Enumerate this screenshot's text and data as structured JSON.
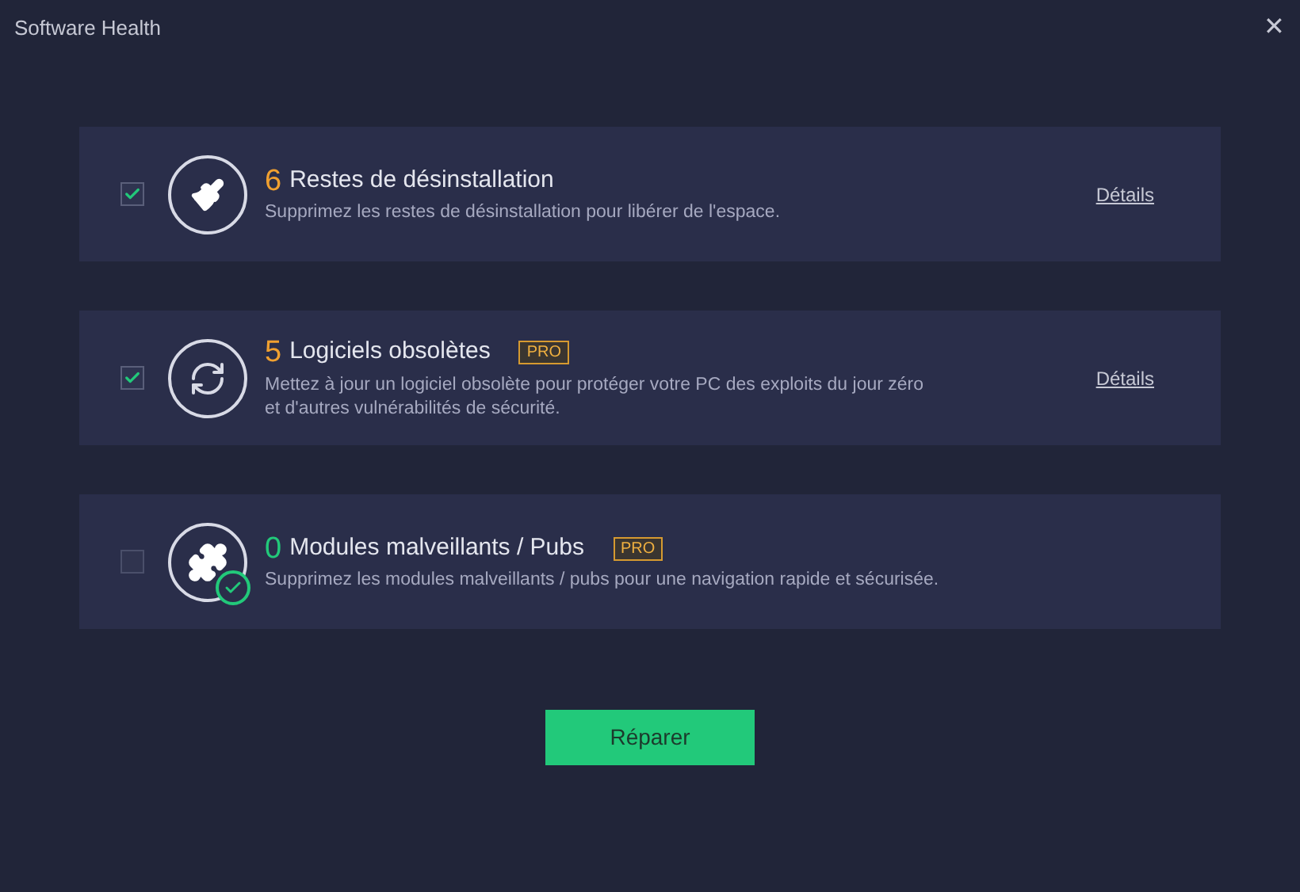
{
  "window": {
    "title": "Software Health",
    "close": "✕"
  },
  "items": [
    {
      "kind": "leftovers",
      "checked": true,
      "count": "6",
      "color": "#f0a030",
      "title": "Restes de désinstallation",
      "description": "Supprimez les restes de désinstallation pour libérer de l'espace.",
      "details": "Détails"
    },
    {
      "kind": "outdated",
      "checked": true,
      "count": "5",
      "color": "#f0a030",
      "title": "Logiciels obsolètes",
      "badge": "PRO",
      "description": "Mettez à jour un logiciel obsolète pour protéger votre PC des exploits du jour zéro\net d'autres vulnérabilités de sécurité.",
      "details": "Détails"
    },
    {
      "kind": "plugins",
      "checked": false,
      "count": "0",
      "color": "#22c97a",
      "title": "Modules malveillants / Pubs",
      "badge": "PRO",
      "description": "Supprimez les modules malveillants / pubs pour une navigation rapide et sécurisée."
    }
  ],
  "button": "Réparer"
}
